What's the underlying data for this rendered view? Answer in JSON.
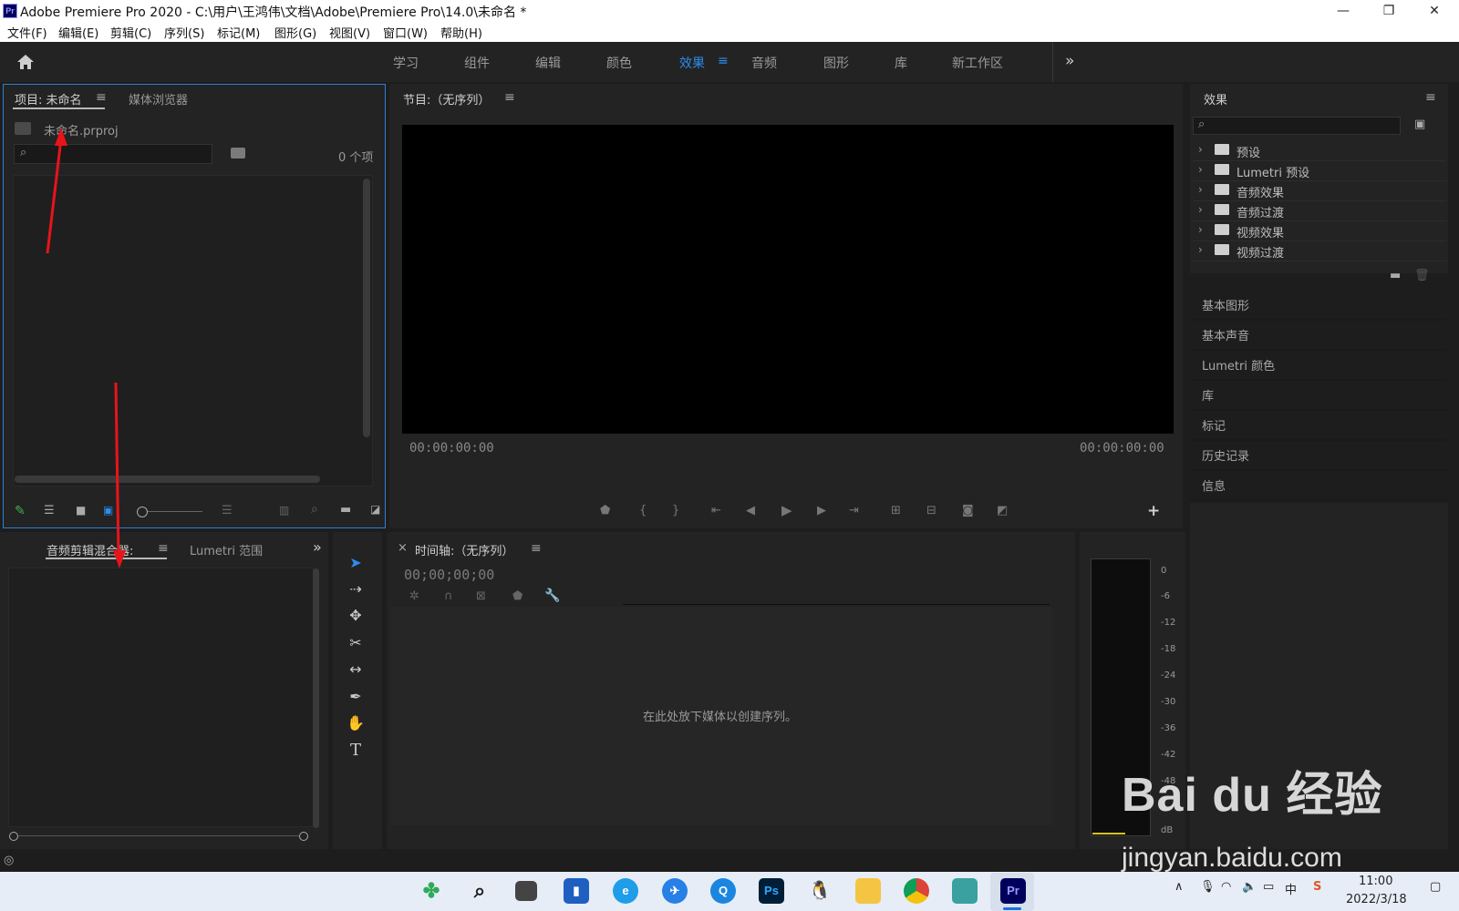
{
  "window": {
    "title": "Adobe Premiere Pro 2020 - C:\\用户\\王鸿伟\\文档\\Adobe\\Premiere Pro\\14.0\\未命名 *",
    "app_icon": "Pr",
    "minimize": "—",
    "restore": "❐",
    "close": "✕"
  },
  "menu": [
    "文件(F)",
    "编辑(E)",
    "剪辑(C)",
    "序列(S)",
    "标记(M)",
    "图形(G)",
    "视图(V)",
    "窗口(W)",
    "帮助(H)"
  ],
  "workspaces": {
    "items": [
      "学习",
      "组件",
      "编辑",
      "颜色",
      "效果",
      "音频",
      "图形",
      "库",
      "新工作区"
    ],
    "active": "效果",
    "overflow": "»"
  },
  "project_panel": {
    "tab_active": "项目: 未命名",
    "tab_other": "媒体浏览器",
    "file_name": "未命名.prproj",
    "item_count": "0 个项",
    "search_placeholder": ""
  },
  "program_monitor": {
    "tab": "节目:（无序列）",
    "timecode_left": "00:00:00:00",
    "timecode_right": "00:00:00:00",
    "add_button": "+"
  },
  "effects_panel": {
    "title": "效果",
    "folders": [
      "预设",
      "Lumetri 预设",
      "音频效果",
      "音频过渡",
      "视频效果",
      "视频过渡"
    ]
  },
  "side_panels": [
    "基本图形",
    "基本声音",
    "Lumetri 颜色",
    "库",
    "标记",
    "历史记录",
    "信息"
  ],
  "audio_panel": {
    "tab_left": "音频剪辑混合器:",
    "tab_right": "Lumetri 范围",
    "overflow": "»"
  },
  "timeline": {
    "close": "×",
    "tab": "时间轴:（无序列）",
    "timecode": "00;00;00;00",
    "empty_message": "在此处放下媒体以创建序列。"
  },
  "audio_meter": {
    "ticks": [
      "0",
      "-6",
      "-12",
      "-18",
      "-24",
      "-30",
      "-36",
      "-42",
      "-48",
      "dB"
    ]
  },
  "taskbar": {
    "time": "11:00",
    "date": "2022/3/18",
    "ime": "中",
    "apps": [
      "start",
      "search",
      "task-view",
      "widgets",
      "edge",
      "feishu",
      "browser",
      "ps",
      "qq",
      "explorer",
      "chrome",
      "notepad",
      "premiere"
    ]
  },
  "watermark": {
    "brand": "Bai du 经验",
    "url": "jingyan.baidu.com"
  },
  "colors": {
    "accent_blue": "#2d8ceb",
    "annotation_red": "#e8141a",
    "panel_bg": "#232323"
  }
}
